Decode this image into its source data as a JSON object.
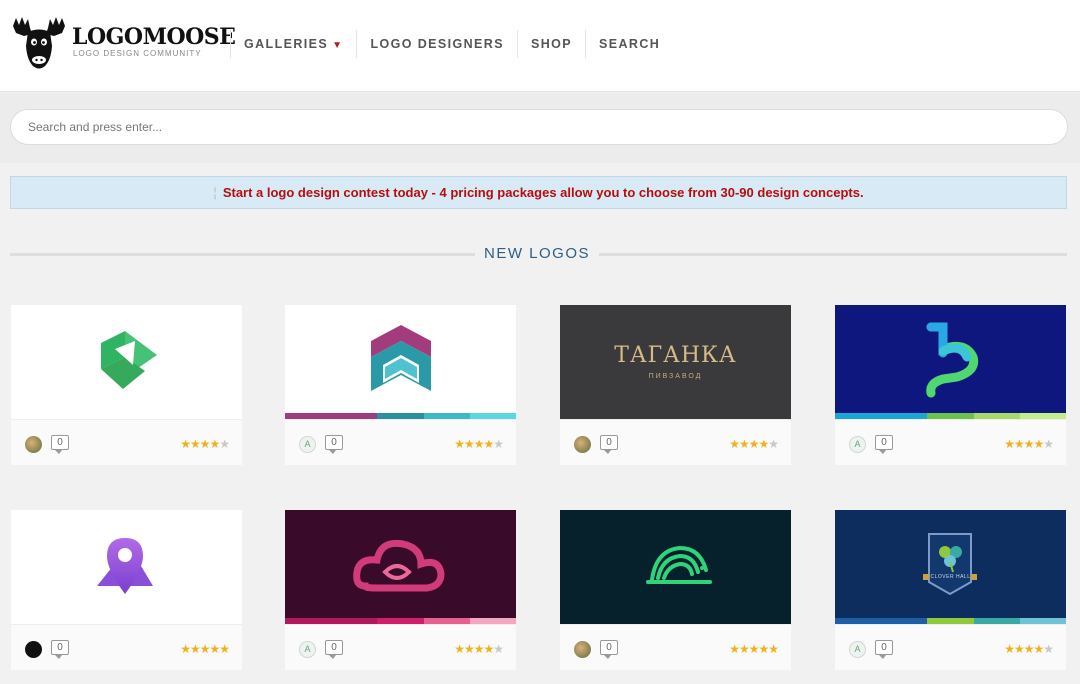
{
  "header": {
    "logo_title": "LOGOMOOSE",
    "logo_subtitle": "LOGO DESIGN COMMUNITY",
    "nav": [
      {
        "label": "GALLERIES",
        "caret": "▼"
      },
      {
        "label": "LOGO DESIGNERS"
      },
      {
        "label": "SHOP"
      },
      {
        "label": "SEARCH"
      }
    ]
  },
  "search": {
    "placeholder": "Search and press enter..."
  },
  "banner": {
    "text": "Start a logo design contest today - 4 pricing packages allow you to choose from 30-90 design concepts."
  },
  "section": {
    "title": "NEW LOGOS"
  },
  "logos": [
    {
      "comments": "0",
      "rating": 4,
      "avatar": "photo",
      "bg": "#ffffff"
    },
    {
      "comments": "0",
      "rating": 4,
      "avatar": "a-badge",
      "bg": "#ffffff",
      "strip": [
        "#9e3c7e",
        "#2c8f9e",
        "#3fb8c8",
        "#5ed6e0"
      ]
    },
    {
      "comments": "0",
      "rating": 4,
      "avatar": "photo",
      "bg": "#3a3a3c",
      "wordmark": "ТАГАНКА",
      "tagline": "ПИВЗАВОД"
    },
    {
      "comments": "0",
      "rating": 4,
      "avatar": "a-badge",
      "bg": "#0d177e",
      "strip": [
        "#1aa7d8",
        "#6cc24a",
        "#a6d96a",
        "#c4ec8a"
      ]
    },
    {
      "comments": "0",
      "rating": 5,
      "avatar": "dark-icon",
      "bg": "#ffffff"
    },
    {
      "comments": "0",
      "rating": 4,
      "avatar": "a-badge",
      "bg": "#3a0a2a",
      "strip": [
        "#b2185e",
        "#d11d6c",
        "#e8608f",
        "#f3a8c0"
      ]
    },
    {
      "comments": "0",
      "rating": 5,
      "avatar": "photo",
      "bg": "#06202c"
    },
    {
      "comments": "0",
      "rating": 4,
      "avatar": "a-badge",
      "bg": "#0c2d5e",
      "strip": [
        "#1f5fa8",
        "#8fc83c",
        "#39a9a3",
        "#6ec3d4"
      ],
      "badge_text": "CLOVER HALL"
    }
  ],
  "colors": {
    "accent_red": "#b80d0d",
    "link_blue": "#2c5e86",
    "star": "#f0b21c"
  }
}
